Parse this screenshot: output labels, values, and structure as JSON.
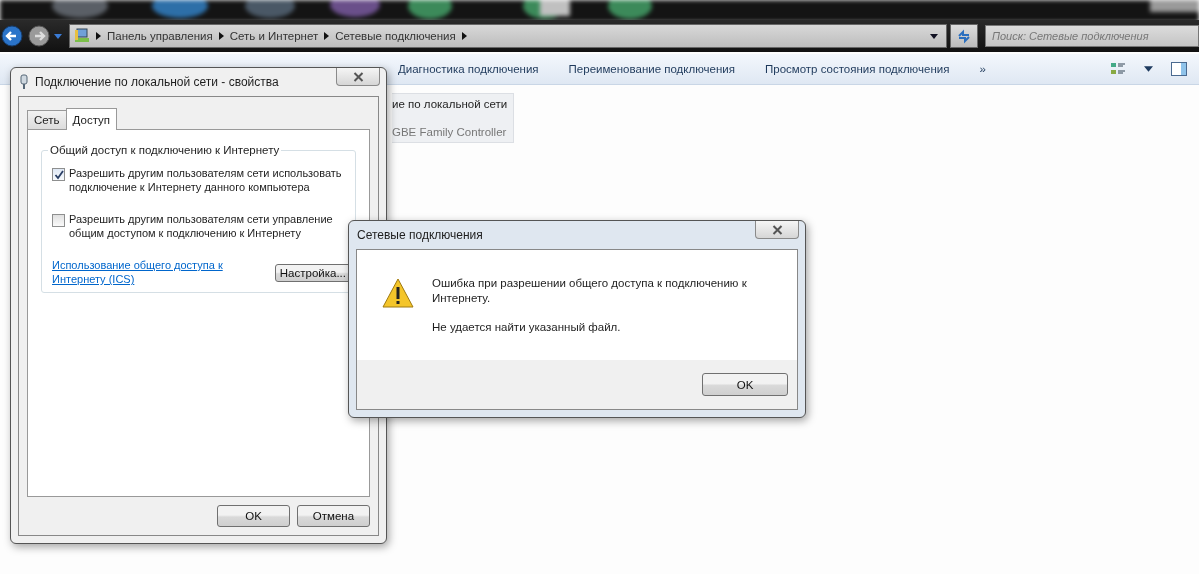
{
  "explorer": {
    "breadcrumbs": [
      "Панель управления",
      "Сеть и Интернет",
      "Сетевые подключения"
    ],
    "search": {
      "placeholder": "Поиск: Сетевые подключения"
    },
    "toolbar": [
      {
        "label": "Диагностика подключения"
      },
      {
        "label": "Переименование подключения"
      },
      {
        "label": "Просмотр состояния подключения"
      },
      {
        "label": "»"
      }
    ],
    "connection_card": {
      "name": "ие по локальной сети",
      "device": "GBE Family Controller"
    }
  },
  "properties_dialog": {
    "title": "Подключение по локальной сети - свойства",
    "tabs": [
      {
        "label": "Сеть",
        "selected": false
      },
      {
        "label": "Доступ",
        "selected": true
      }
    ],
    "group_title": "Общий доступ к подключению к Интернету",
    "options": [
      {
        "label": "Разрешить другим пользователям сети использовать подключение к Интернету данного компьютера",
        "checked": true
      },
      {
        "label": "Разрешить другим пользователям сети управление общим доступом к подключению к Интернету",
        "checked": false
      }
    ],
    "help_link": "Использование общего доступа к Интернету (ICS)",
    "settings_button": "Настройка...",
    "buttons": [
      "OK",
      "Отмена"
    ]
  },
  "error_dialog": {
    "title": "Сетевые подключения",
    "message": "Ошибка при разрешении общего доступа к подключению к Интернету.",
    "detail": "Не удается найти указанный файл.",
    "button": "OK"
  }
}
